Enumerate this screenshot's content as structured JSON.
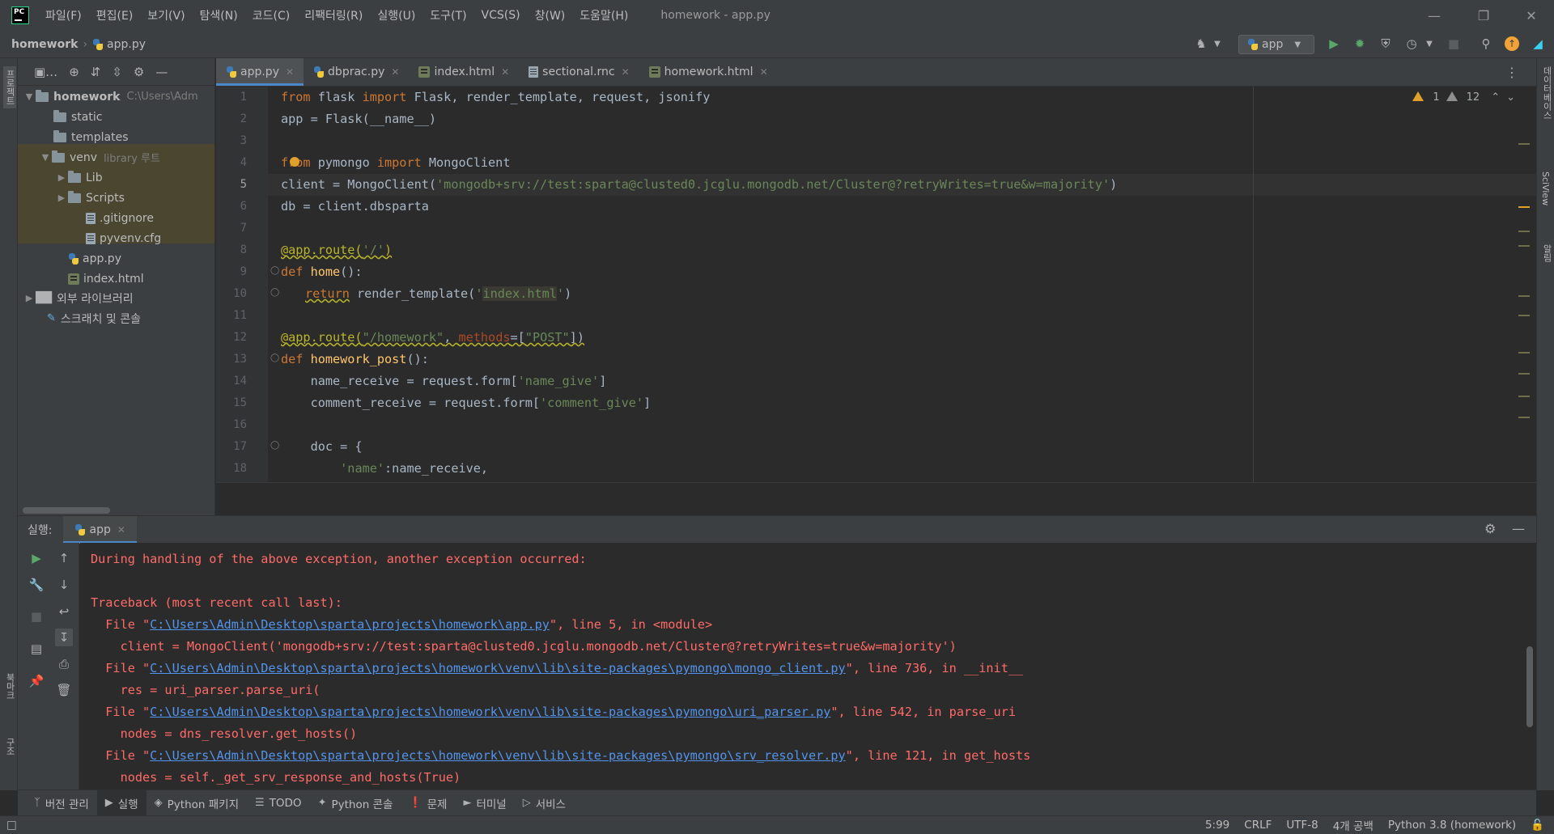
{
  "menubar": {
    "items": [
      "파일(F)",
      "편집(E)",
      "보기(V)",
      "탐색(N)",
      "코드(C)",
      "리팩터링(R)",
      "실행(U)",
      "도구(T)",
      "VCS(S)",
      "창(W)",
      "도움말(H)"
    ],
    "window_title": "homework - app.py"
  },
  "navbar": {
    "project": "homework",
    "file": "app.py",
    "run_config": "app"
  },
  "left_stripe": {
    "project_label": "프로젝트",
    "bookmarks_label": "북마크",
    "structure_label": "구조"
  },
  "right_stripe": {
    "database_label": "데이터베이스",
    "sciview_label": "SciView",
    "notifications_label": "알림"
  },
  "project_tree": {
    "rows": [
      {
        "label": "homework",
        "hint": "C:\\Users\\Adm"
      },
      {
        "label": "static"
      },
      {
        "label": "templates"
      },
      {
        "label": "venv",
        "hint": "library 루트"
      },
      {
        "label": "Lib"
      },
      {
        "label": "Scripts"
      },
      {
        "label": ".gitignore"
      },
      {
        "label": "pyvenv.cfg"
      },
      {
        "label": "app.py"
      },
      {
        "label": "index.html"
      },
      {
        "label": "외부 라이브러리"
      },
      {
        "label": "스크래치 및 콘솔"
      }
    ]
  },
  "tabs": [
    {
      "label": "app.py",
      "active": true
    },
    {
      "label": "dbprac.py"
    },
    {
      "label": "index.html"
    },
    {
      "label": "sectional.rnc"
    },
    {
      "label": "homework.html"
    }
  ],
  "editor": {
    "warnings": "1",
    "weak_warnings": "12",
    "line_numbers": [
      "1",
      "2",
      "3",
      "4",
      "5",
      "6",
      "7",
      "8",
      "9",
      "10",
      "11",
      "12",
      "13",
      "14",
      "15",
      "16",
      "17",
      "18"
    ],
    "lines": {
      "l1": {
        "a": "from",
        "b": " flask ",
        "c": "import",
        "d": " Flask, render_template, request, jsonify"
      },
      "l2": "app = Flask(__name__)",
      "l4": {
        "a": "from",
        "b": " pymongo ",
        "c": "import",
        "d": " MongoClient"
      },
      "l5": {
        "a": "client = MongoClient(",
        "b": "'mongodb+srv://test:sparta@clusted0.jcglu.mongodb.net/Cluster@?retryWrites=true&w=majority'",
        "c": ")"
      },
      "l6": "db = client.dbsparta",
      "l8": {
        "a": "@app.route(",
        "b": "'/'",
        "c": ")"
      },
      "l9": {
        "a": "def",
        "b": " home",
        "c": "():"
      },
      "l10": {
        "a": "return",
        "b": " render_template(",
        "c": "'",
        "d": "index.html",
        "e": "'",
        "f": ")"
      },
      "l12": {
        "a": "@app.route(",
        "b": "\"/homework\"",
        "c": ", ",
        "d": "methods",
        "e": "=[",
        "f": "\"POST\"",
        "g": "])"
      },
      "l13": {
        "a": "def",
        "b": " homework_post",
        "c": "():"
      },
      "l14": {
        "a": "    name_receive = request.form[",
        "b": "'name_give'",
        "c": "]"
      },
      "l15": {
        "a": "    comment_receive = request.form[",
        "b": "'comment_give'",
        "c": "]"
      },
      "l17": "    doc = {",
      "l18": {
        "a": "        ",
        "b": "'name'",
        "c": ":name_receive,"
      }
    }
  },
  "run_panel": {
    "label": "실행:",
    "tab": "app",
    "console": {
      "c1": "During handling of the above exception, another exception occurred:",
      "c2": "Traceback (most recent call last):",
      "c3": {
        "a": "  File \"",
        "link": "C:\\Users\\Admin\\Desktop\\sparta\\projects\\homework\\app.py",
        "b": "\", line 5, in <module>"
      },
      "c4": "    client = MongoClient('mongodb+srv://test:sparta@clusted0.jcglu.mongodb.net/Cluster@?retryWrites=true&w=majority')",
      "c5": {
        "a": "  File \"",
        "link": "C:\\Users\\Admin\\Desktop\\sparta\\projects\\homework\\venv\\lib\\site-packages\\pymongo\\mongo_client.py",
        "b": "\", line 736, in __init__"
      },
      "c6": "    res = uri_parser.parse_uri(",
      "c7": {
        "a": "  File \"",
        "link": "C:\\Users\\Admin\\Desktop\\sparta\\projects\\homework\\venv\\lib\\site-packages\\pymongo\\uri_parser.py",
        "b": "\", line 542, in parse_uri"
      },
      "c8": "    nodes = dns_resolver.get_hosts()",
      "c9": {
        "a": "  File \"",
        "link": "C:\\Users\\Admin\\Desktop\\sparta\\projects\\homework\\venv\\lib\\site-packages\\pymongo\\srv_resolver.py",
        "b": "\", line 121, in get_hosts"
      },
      "c10": "    nodes = self._get_srv_response_and_hosts(True)"
    }
  },
  "bottom_tools": [
    "버전 관리",
    "실행",
    "Python 패키지",
    "TODO",
    "Python 콘솔",
    "문제",
    "터미널",
    "서비스"
  ],
  "statusbar": {
    "position": "5:99",
    "line_sep": "CRLF",
    "encoding": "UTF-8",
    "indent": "4개 공백",
    "interpreter": "Python 3.8 (homework)"
  },
  "colors": {
    "accent": "#4a88c7",
    "error_text": "#ff6b68",
    "link": "#5394ec",
    "keyword": "#cc7832",
    "string": "#6a8759",
    "decorator": "#bbb529"
  },
  "icons": [
    "pycharm-logo-icon",
    "python-file-icon",
    "html-file-icon",
    "run-icon",
    "debug-icon",
    "coverage-icon",
    "profile-icon",
    "stop-icon",
    "search-icon",
    "update-icon",
    "toolbox-icon",
    "gear-icon",
    "minimize-icon",
    "warning-icon"
  ]
}
